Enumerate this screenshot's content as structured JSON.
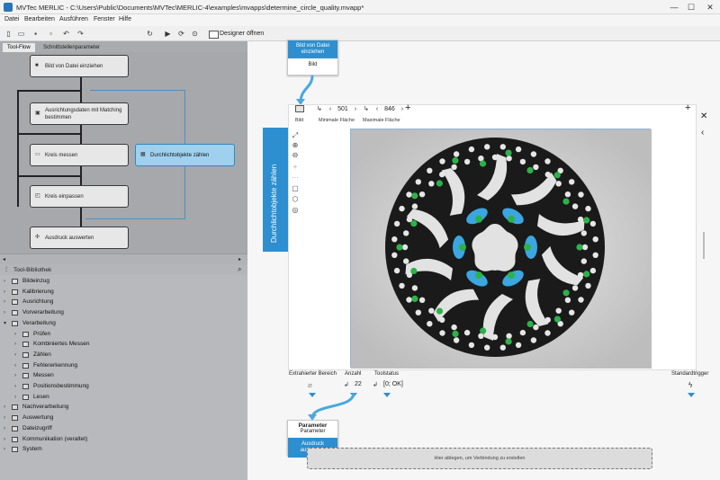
{
  "window": {
    "title": "MVTec MERLIC - C:\\Users\\Public\\Documents\\MVTec\\MERLIC-4\\examples\\mvapps\\determine_circle_quality.mvapp*",
    "minimize": "—",
    "maximize": "☐",
    "close": "✕"
  },
  "menu": [
    "Datei",
    "Bearbeiten",
    "Ausführen",
    "Fenster",
    "Hilfe"
  ],
  "toolbar": {
    "designer": "Designer öffnen"
  },
  "tabs": [
    "Tool-Flow",
    "Schnittstellenparameter"
  ],
  "flow": {
    "nodes": [
      "Bild von Datei einziehen",
      "Ausrichtungsdaten mit Matching bestimmen",
      "Kreis messen",
      "Durchlichtobjekte zählen",
      "Kreis einpassen",
      "Ausdruck auswerten"
    ]
  },
  "library": {
    "title": "Tool-Bibliothek",
    "items": [
      "Bildeinzug",
      "Kalibrierung",
      "Ausrichtung",
      "Vorverarbeitung",
      "Verarbeitung",
      "Prüfen",
      "Kombiniertes Messen",
      "Zählen",
      "Fehlererkennung",
      "Messen",
      "Positionsbestimmung",
      "Lesen",
      "Nachverarbeitung",
      "Auswertung",
      "Dateizugriff",
      "Kommunikation (veraltet)",
      "System"
    ]
  },
  "canvas": {
    "source_node": {
      "title": "Bild von Datei einziehen",
      "output": "Bild"
    },
    "tool_title": "Durchlichtobjekte zählen",
    "input_image_label": "Bild",
    "min_area": {
      "label": "Minimale Fläche",
      "value": "501"
    },
    "max_area": {
      "label": "Maximale Fläche",
      "value": "846"
    },
    "outputs": {
      "extracted_label": "Extrahierter Bereich",
      "count_label": "Anzahl",
      "count_value": "22",
      "status_label": "Toolstatus",
      "status_value": "[0; OK]",
      "trigger_label": "Standardtrigger"
    },
    "next_node": {
      "title": "Parameter",
      "subtitle": "Parameter",
      "name": "Ausdruck auswerten"
    },
    "dropzone": "Hier ablegen, um Verbindung zu erstellen"
  },
  "colors": {
    "accent": "#2d8fd0",
    "highlight": "#9fd1ef"
  }
}
